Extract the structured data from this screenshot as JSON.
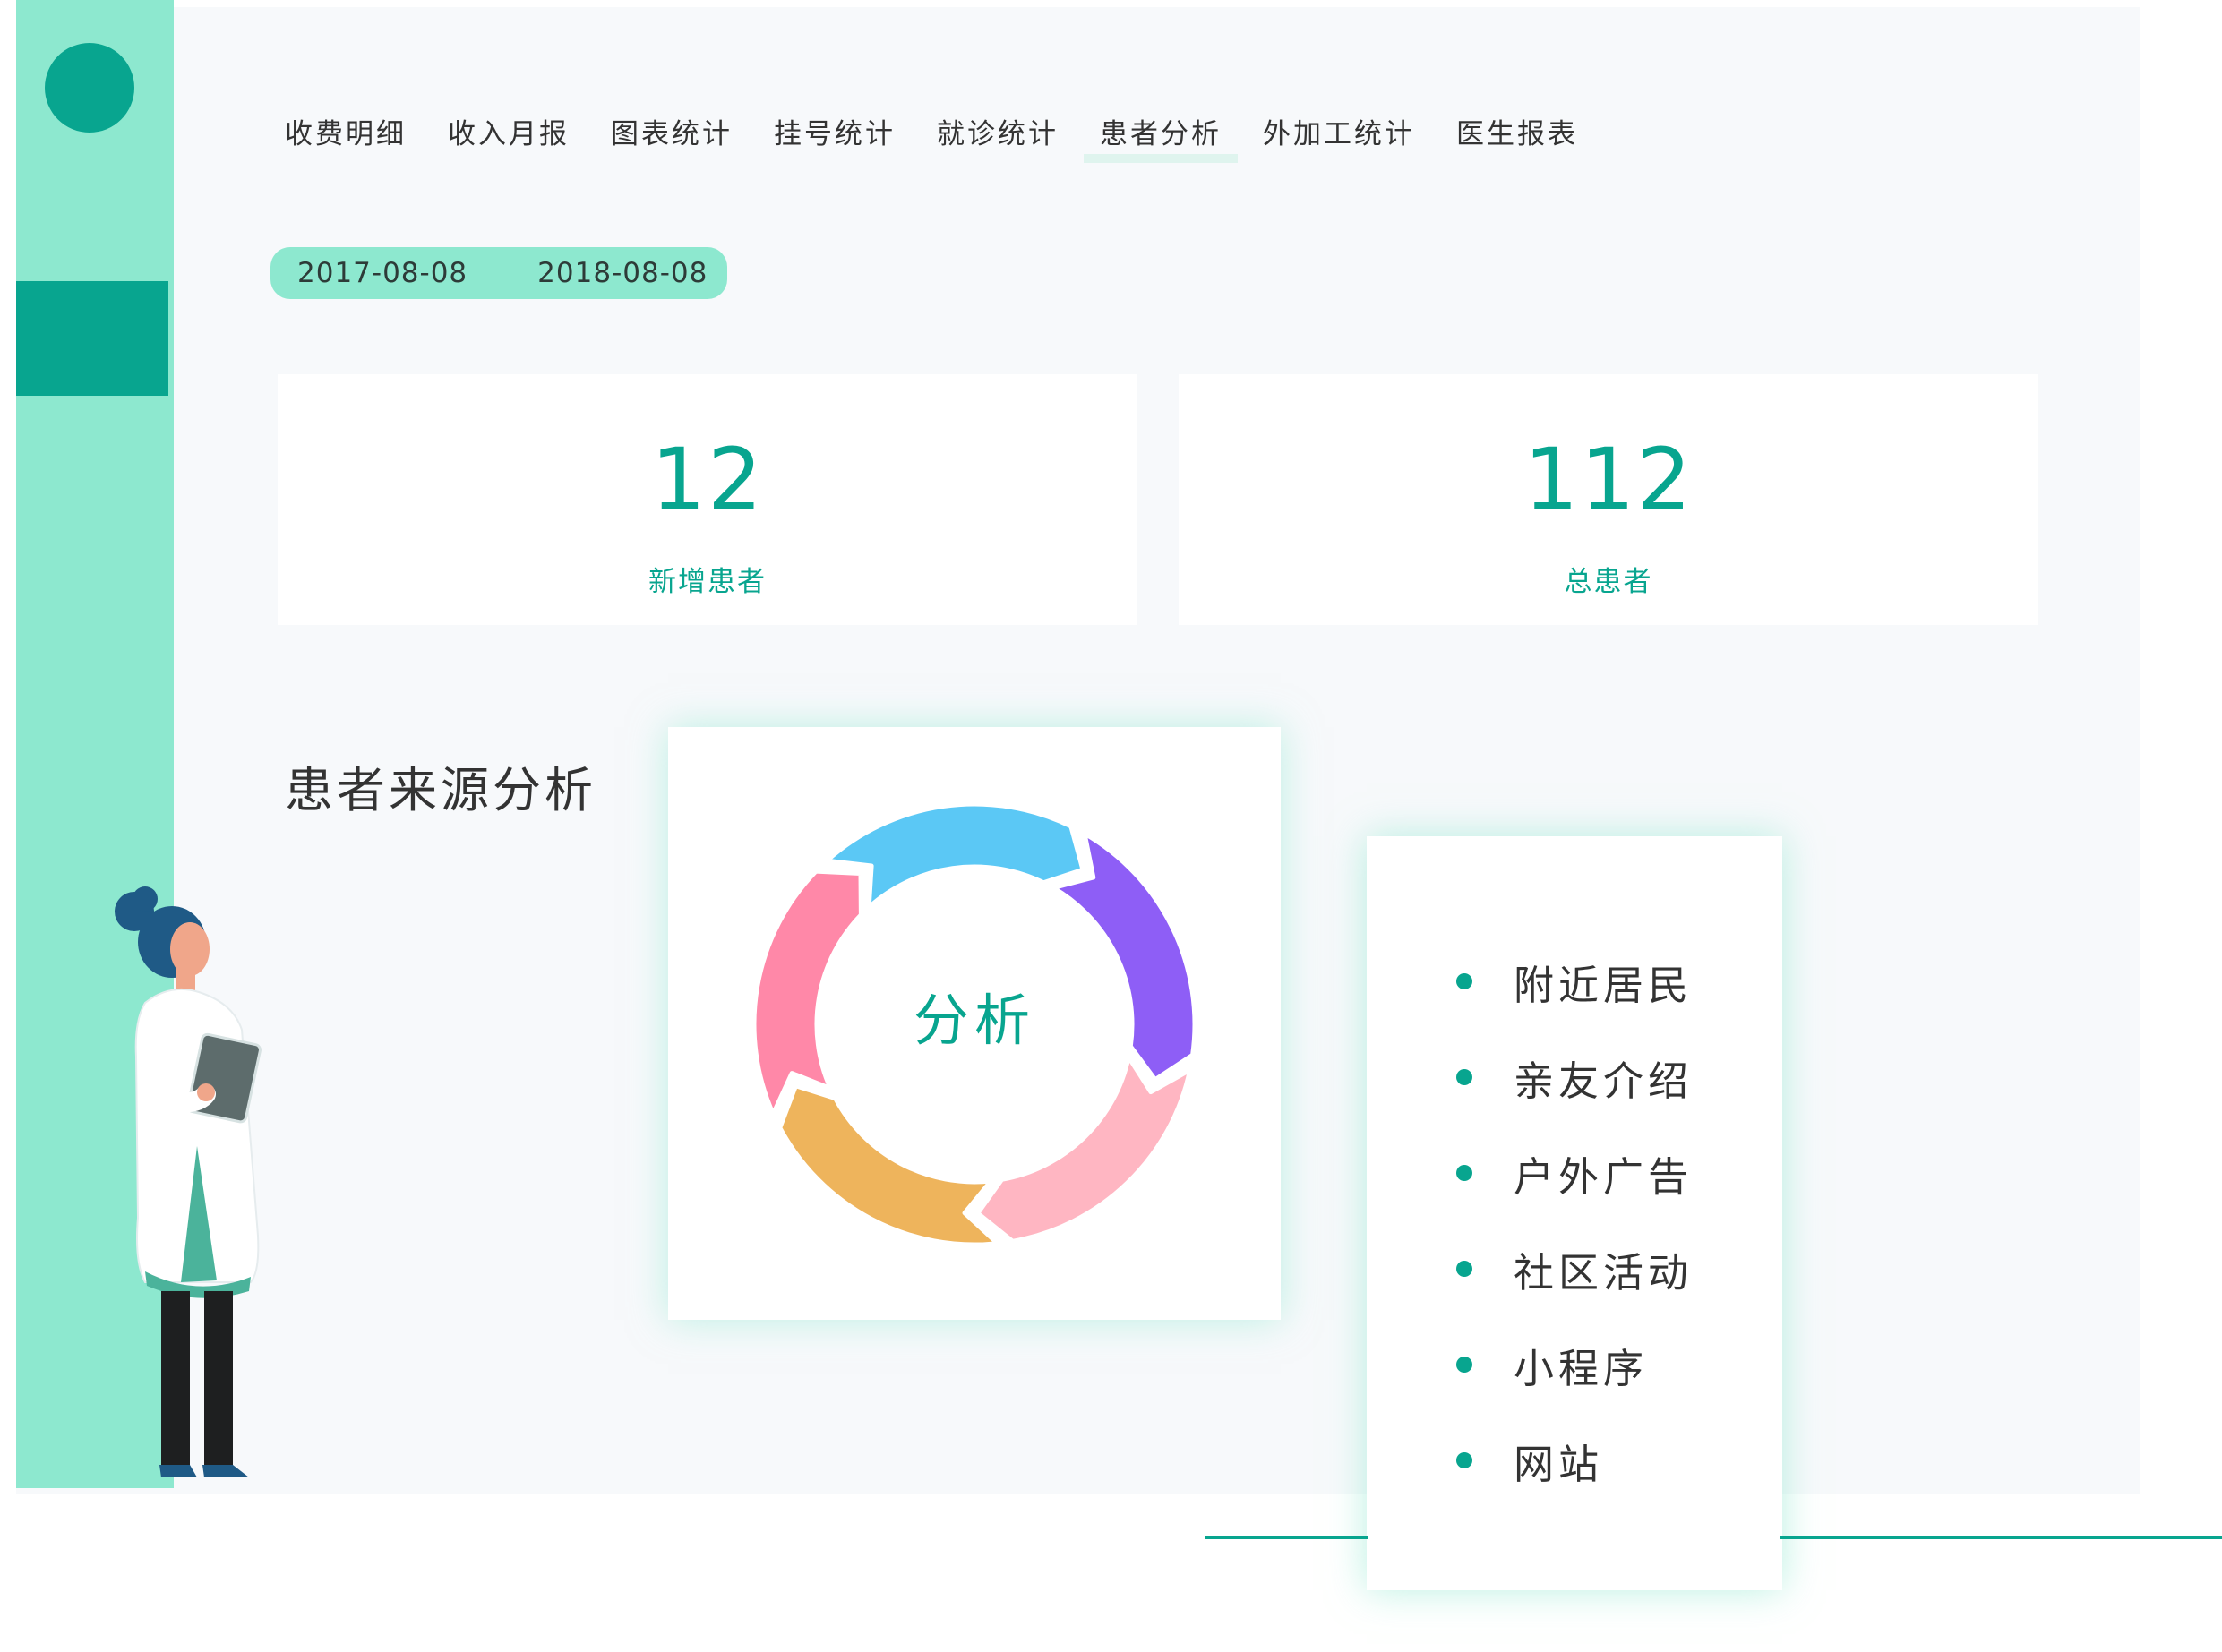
{
  "tabs": [
    {
      "label": "收费明细"
    },
    {
      "label": "收入月报"
    },
    {
      "label": "图表统计"
    },
    {
      "label": "挂号统计"
    },
    {
      "label": "就诊统计"
    },
    {
      "label": "患者分析",
      "active": true
    },
    {
      "label": "外加工统计"
    },
    {
      "label": "医生报表"
    }
  ],
  "date_range": {
    "start": "2017-08-08",
    "end": "2018-08-08"
  },
  "stats": {
    "new_patients": {
      "value": "12",
      "label": "新增患者"
    },
    "total_patients": {
      "value": "112",
      "label": "总患者"
    }
  },
  "section": {
    "title": "患者来源分析"
  },
  "donut": {
    "center_label": "分析",
    "segments": [
      {
        "color": "#8e5ef6"
      },
      {
        "color": "#ffb6c2"
      },
      {
        "color": "#eeb45c"
      },
      {
        "color": "#ff88a8"
      },
      {
        "color": "#5bc8f5"
      }
    ]
  },
  "legend": {
    "items": [
      {
        "label": "附近居民"
      },
      {
        "label": "亲友介绍"
      },
      {
        "label": "户外广告"
      },
      {
        "label": "社区活动"
      },
      {
        "label": "小程序"
      },
      {
        "label": "网站"
      }
    ]
  },
  "colors": {
    "accent": "#08a58f",
    "sidebar": "#8de8cf",
    "panel": "#f7f9fb"
  },
  "icons": {
    "logo": "circle-logo-icon",
    "illustration": "doctor-illustration"
  }
}
